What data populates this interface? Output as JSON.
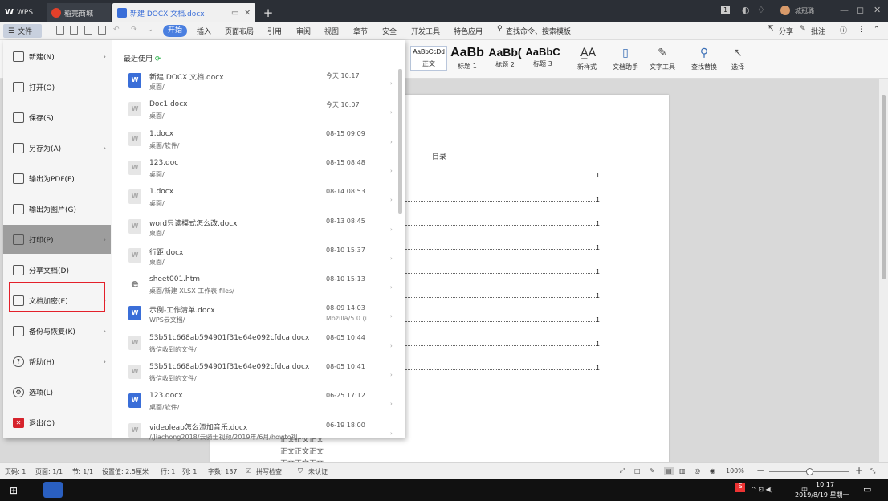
{
  "tabs": {
    "wps": "WPS",
    "store": "稻壳商城",
    "doc": "新建 DOCX 文档.docx",
    "add": "+"
  },
  "window": {
    "badge": "1",
    "user": "城冠璐",
    "minimize": "—",
    "restore": "◻",
    "close": "✕"
  },
  "menubar": {
    "file": "文件",
    "tabs": [
      "开始",
      "插入",
      "页面布局",
      "引用",
      "审阅",
      "视图",
      "章节",
      "安全",
      "开发工具",
      "特色应用"
    ],
    "search": "查找命令、搜索模板",
    "share": "分享",
    "comment": "批注"
  },
  "ribbon": {
    "styles": [
      {
        "sample": "AaBbCcDd",
        "name": "正文"
      },
      {
        "sample": "AaBb",
        "name": "标题 1"
      },
      {
        "sample": "AaBb(",
        "name": "标题 2"
      },
      {
        "sample": "AaBbC",
        "name": "标题 3"
      }
    ],
    "new_style": "新样式",
    "doc_helper": "文档助手",
    "text_tools": "文字工具",
    "find_replace": "查找替换",
    "select": "选择"
  },
  "document": {
    "toc_title": "目录",
    "toc_pages": [
      "1",
      "1",
      "1",
      "1",
      "1",
      "1",
      "1",
      "1",
      "1"
    ],
    "body_lines": [
      "正文正文正文",
      "正文正文正文",
      "正文正文正文"
    ]
  },
  "file_menu": {
    "items": [
      {
        "label": "新建(N)",
        "icon": "new-doc-icon",
        "arrow": true
      },
      {
        "label": "打开(O)",
        "icon": "folder-open-icon",
        "arrow": false
      },
      {
        "label": "保存(S)",
        "icon": "save-icon",
        "arrow": false
      },
      {
        "label": "另存为(A)",
        "icon": "save-as-icon",
        "arrow": true
      },
      {
        "label": "输出为PDF(F)",
        "icon": "pdf-icon",
        "arrow": false
      },
      {
        "label": "输出为图片(G)",
        "icon": "image-export-icon",
        "arrow": false
      },
      {
        "label": "打印(P)",
        "icon": "printer-icon",
        "arrow": true
      },
      {
        "label": "分享文档(D)",
        "icon": "share-icon",
        "arrow": false
      },
      {
        "label": "文档加密(E)",
        "icon": "encrypt-icon",
        "arrow": true
      },
      {
        "label": "备份与恢复(K)",
        "icon": "backup-icon",
        "arrow": true
      },
      {
        "label": "帮助(H)",
        "icon": "help-icon",
        "arrow": true
      },
      {
        "label": "选项(L)",
        "icon": "settings-icon",
        "arrow": false
      },
      {
        "label": "退出(Q)",
        "icon": "exit-icon",
        "arrow": false
      }
    ],
    "active_item": "打印(P)",
    "highlighted_item": "文档加密(E)",
    "recent_title": "最近使用",
    "recent": [
      {
        "name": "新建 DOCX 文档.docx",
        "path": "桌面/",
        "time": "今天 10:17",
        "sub": "",
        "type": "docx"
      },
      {
        "name": "Doc1.docx",
        "path": "桌面/",
        "time": "今天 10:07",
        "sub": "",
        "type": "docx-gray"
      },
      {
        "name": "1.docx",
        "path": "桌面/软件/",
        "time": "08-15 09:09",
        "sub": "",
        "type": "docx-gray"
      },
      {
        "name": "123.doc",
        "path": "桌面/",
        "time": "08-15 08:48",
        "sub": "",
        "type": "docx-gray"
      },
      {
        "name": "1.docx",
        "path": "桌面/",
        "time": "08-14 08:53",
        "sub": "",
        "type": "docx-gray"
      },
      {
        "name": "word只读模式怎么改.docx",
        "path": "桌面/",
        "time": "08-13 08:45",
        "sub": "",
        "type": "docx-gray"
      },
      {
        "name": "行距.docx",
        "path": "桌面/",
        "time": "08-10 15:37",
        "sub": "",
        "type": "docx-gray"
      },
      {
        "name": "sheet001.htm",
        "path": "桌面/新建 XLSX 工作表.files/",
        "time": "08-10 15:13",
        "sub": "",
        "type": "htm"
      },
      {
        "name": "示例-工作清单.docx",
        "path": "WPS云文档/",
        "time": "08-09 14:03",
        "sub": "Mozilla/5.0 (i...",
        "type": "docx"
      },
      {
        "name": "53b51c668ab594901f31e64e092cfdca.docx",
        "path": "微信收到的文件/",
        "time": "08-05 10:44",
        "sub": "",
        "type": "docx-gray"
      },
      {
        "name": "53b51c668ab594901f31e64e092cfdca.docx",
        "path": "微信收到的文件/",
        "time": "08-05 10:41",
        "sub": "",
        "type": "docx-gray"
      },
      {
        "name": "123.docx",
        "path": "桌面/软件/",
        "time": "06-25 17:12",
        "sub": "",
        "type": "docx"
      },
      {
        "name": "videoleap怎么添加音乐.docx",
        "path": "//Jiachong2018/云骑士视频/2019年/6月/howto视...",
        "time": "06-19 18:00",
        "sub": "",
        "type": "docx-gray"
      }
    ]
  },
  "statusbar": {
    "page_num": "页码: 1",
    "pages": "页面: 1/1",
    "section": "节: 1/1",
    "setting": "设置值: 2.5厘米",
    "row": "行: 1",
    "col": "列: 1",
    "words": "字数: 137",
    "spell": "拼写检查",
    "auth": "未认证",
    "zoom": "100%"
  },
  "taskbar": {
    "time": "10:17",
    "date": "2019/8/19 星期一"
  },
  "colors": {
    "accent": "#4a7fe0",
    "highlight_border": "#e3202a",
    "active_menu": "#9d9d9d"
  }
}
